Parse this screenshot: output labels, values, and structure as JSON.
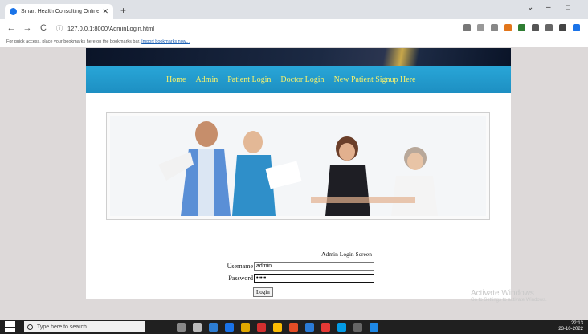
{
  "browser": {
    "tab_title": "Smart Health Consulting Online",
    "tab_close": "✕",
    "new_tab": "+",
    "back": "←",
    "forward": "→",
    "reload": "C",
    "url": "127.0.0.1:8000/AdminLogin.html",
    "bookmarks_text": "For quick access, place your bookmarks here on the bookmarks bar.",
    "bookmarks_link": "Import bookmarks now...",
    "minimize": "⌄",
    "restore": "–",
    "maximize": "□"
  },
  "nav": {
    "items": [
      "Home",
      "Admin",
      "Patient Login",
      "Doctor Login",
      "New Patient Signup Here"
    ]
  },
  "login": {
    "title": "Admin Login Screen",
    "username_label": "Username",
    "username_value": "admin",
    "password_label": "Password",
    "password_value": "•••••",
    "button_label": "Login"
  },
  "watermark": {
    "line1": "Activate Windows",
    "line2": "Go to Settings to activate Windows."
  },
  "taskbar": {
    "search_placeholder": "Type here to search",
    "time": "22:13",
    "date": "23-10-2022"
  },
  "colors": {
    "nav_bg": "#1d8fc2",
    "nav_text": "#f8f26a",
    "accent": "#1a73e8"
  }
}
